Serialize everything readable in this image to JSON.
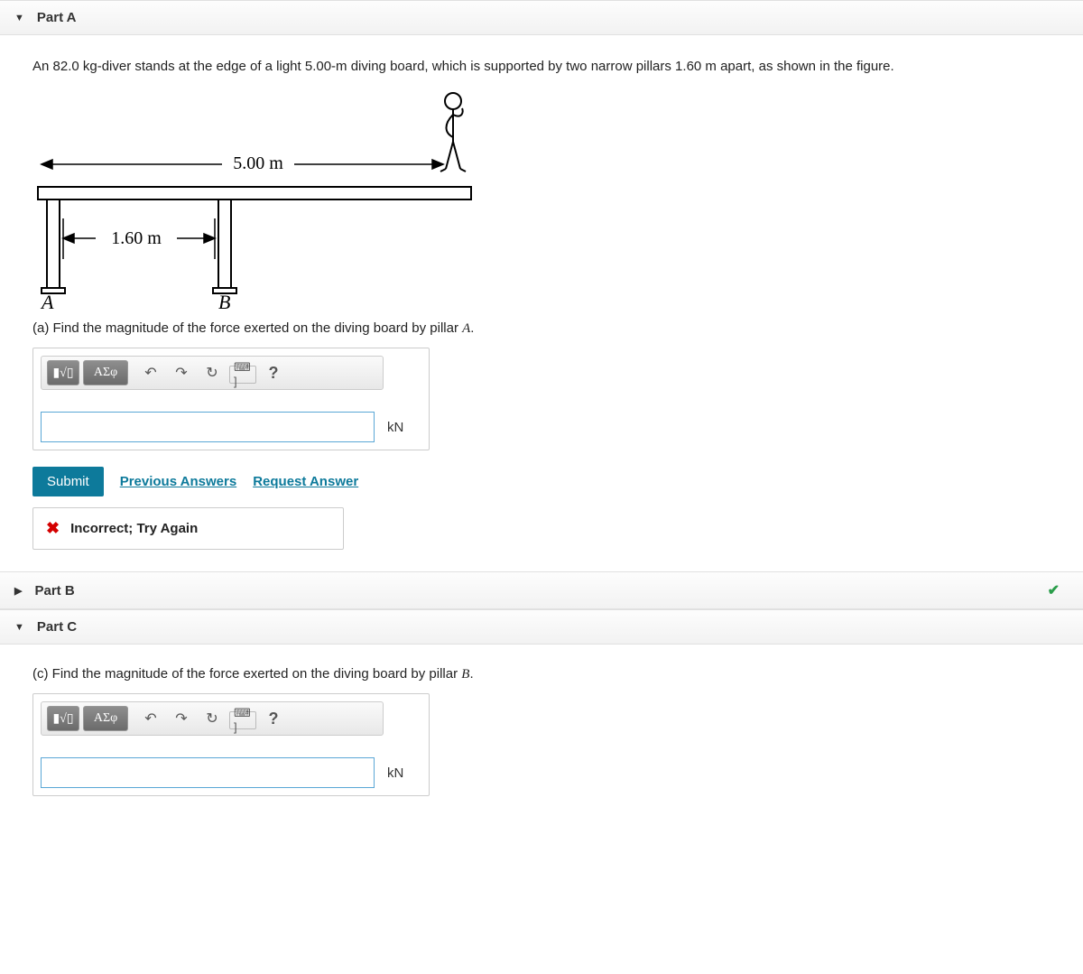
{
  "partA": {
    "title": "Part A",
    "question": "An 82.0 kg-diver stands at the edge of a light 5.00-m diving board, which is supported by two narrow pillars 1.60 m apart, as shown in the figure.",
    "figure": {
      "topLabel": "5.00 m",
      "bottomLabel": "1.60 m",
      "pillarA": "A",
      "pillarB": "B"
    },
    "prompt_prefix": "(a) Find the magnitude of the force exerted on the diving board by pillar ",
    "prompt_var": "A",
    "prompt_suffix": ".",
    "toolbar": {
      "templates_label": "▮√▯",
      "greek_label": "ΑΣφ",
      "keyboard_label": "⌨ ]"
    },
    "input_value": "",
    "unit": "kN",
    "submit_label": "Submit",
    "prev_answers_label": "Previous Answers",
    "request_answer_label": "Request Answer",
    "feedback": "Incorrect; Try Again"
  },
  "partB": {
    "title": "Part B"
  },
  "partC": {
    "title": "Part C",
    "prompt_prefix": "(c) Find the magnitude of the force exerted on the diving board by pillar ",
    "prompt_var": "B",
    "prompt_suffix": ".",
    "toolbar": {
      "templates_label": "▮√▯",
      "greek_label": "ΑΣφ",
      "keyboard_label": "⌨ ]"
    },
    "input_value": "",
    "unit": "kN"
  }
}
